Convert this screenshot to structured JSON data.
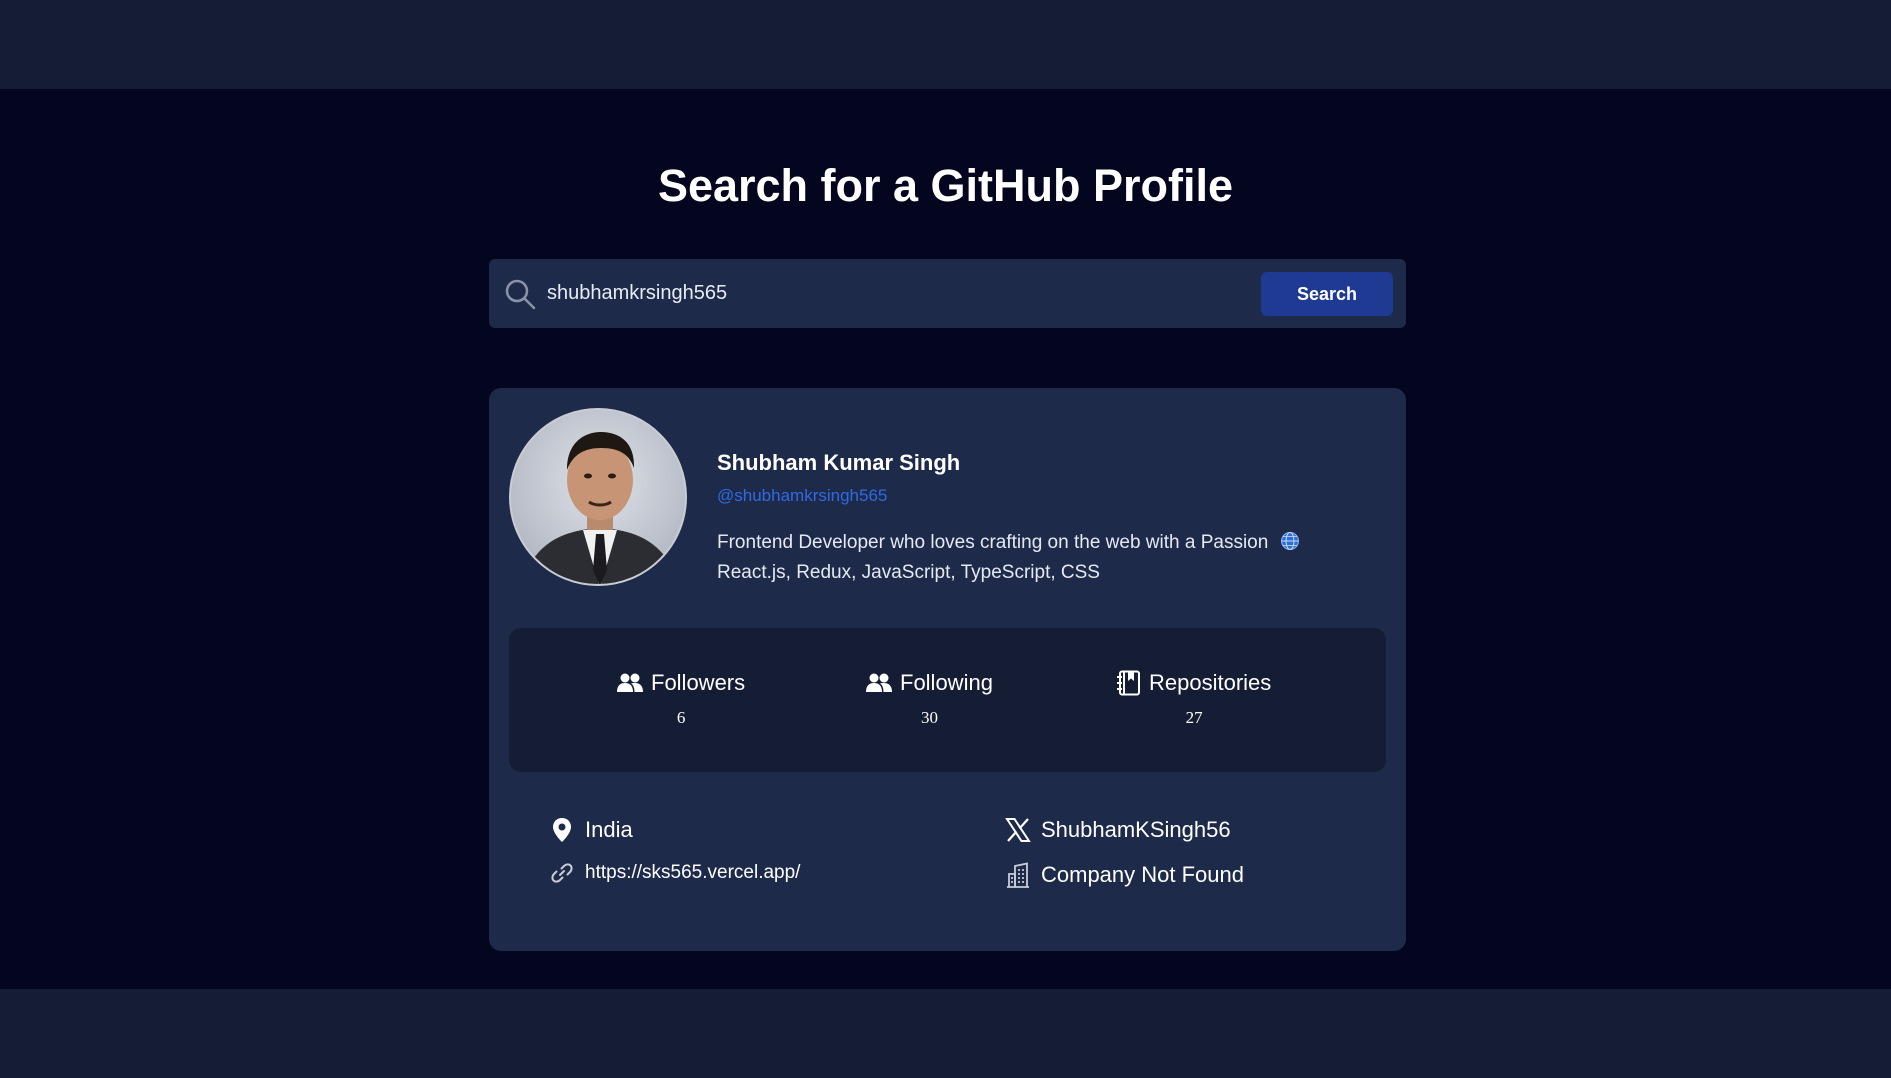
{
  "page": {
    "title": "Search for a GitHub Profile"
  },
  "search": {
    "value": "shubhamkrsingh565",
    "button_label": "Search",
    "icon": "search-icon"
  },
  "profile": {
    "name": "Shubham Kumar Singh",
    "login": "@shubhamkrsingh565",
    "bio_line1": "Frontend Developer who loves crafting on the web with a Passion",
    "bio_line2": "React.js, Redux, JavaScript, TypeScript, CSS",
    "bio_icon": "globe-icon"
  },
  "stats": [
    {
      "label": "Followers",
      "value": "6",
      "icon": "users-icon"
    },
    {
      "label": "Following",
      "value": "30",
      "icon": "users-icon"
    },
    {
      "label": "Repositories",
      "value": "27",
      "icon": "book-icon"
    }
  ],
  "info": {
    "location": "India",
    "website": "https://sks565.vercel.app/",
    "twitter": "ShubhamKSingh56",
    "company": "Company Not Found"
  },
  "colors": {
    "page_background": "#03061e",
    "band_background": "#141d33",
    "card_background": "#1e2a4a",
    "button_background": "#1f3a93",
    "link_color": "#2f6ae0"
  }
}
